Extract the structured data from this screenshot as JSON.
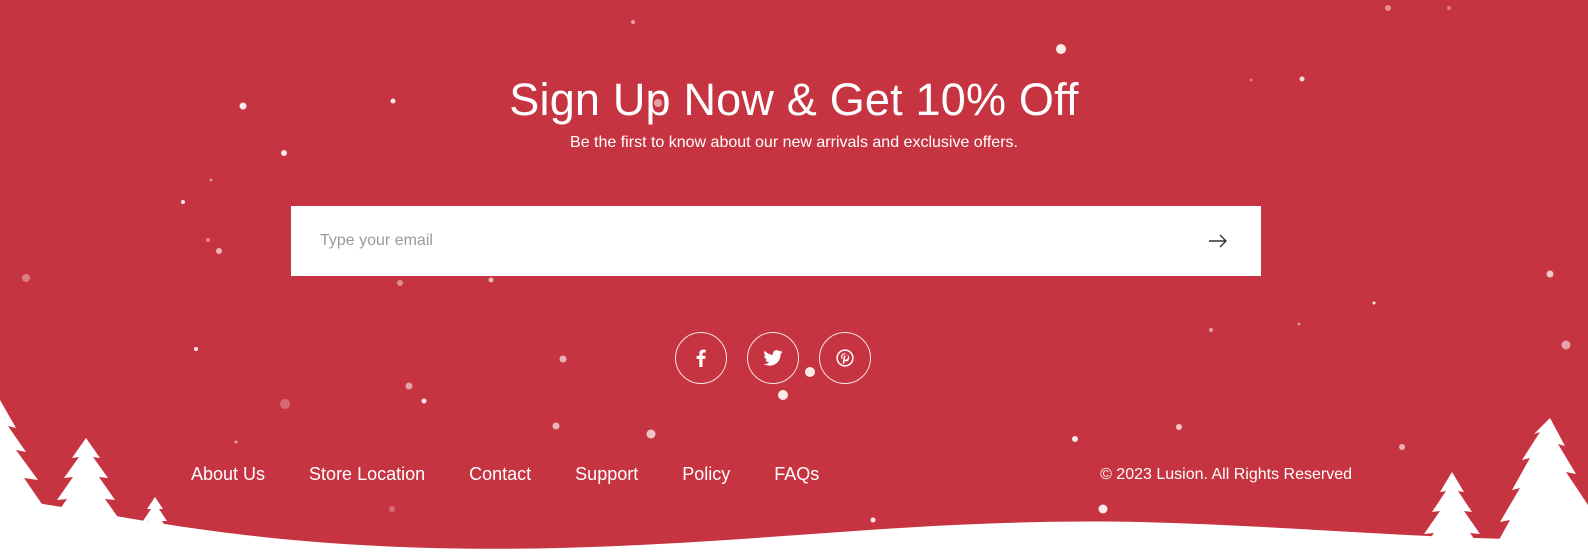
{
  "newsletter": {
    "title": "Sign Up Now & Get 10% Off",
    "subtitle": "Be the first to know about our new arrivals and exclusive offers.",
    "email_placeholder": "Type your email",
    "submit_icon": "arrow-right-icon"
  },
  "social": [
    {
      "name": "facebook",
      "icon": "facebook-icon"
    },
    {
      "name": "twitter",
      "icon": "twitter-icon"
    },
    {
      "name": "pinterest",
      "icon": "pinterest-icon"
    }
  ],
  "footer": {
    "links": [
      "About Us",
      "Store Location",
      "Contact",
      "Support",
      "Policy",
      "FAQs"
    ],
    "copyright": "© 2023 Lusion. All Rights Reserved"
  },
  "colors": {
    "background": "#c73441",
    "foreground": "#ffffff"
  }
}
